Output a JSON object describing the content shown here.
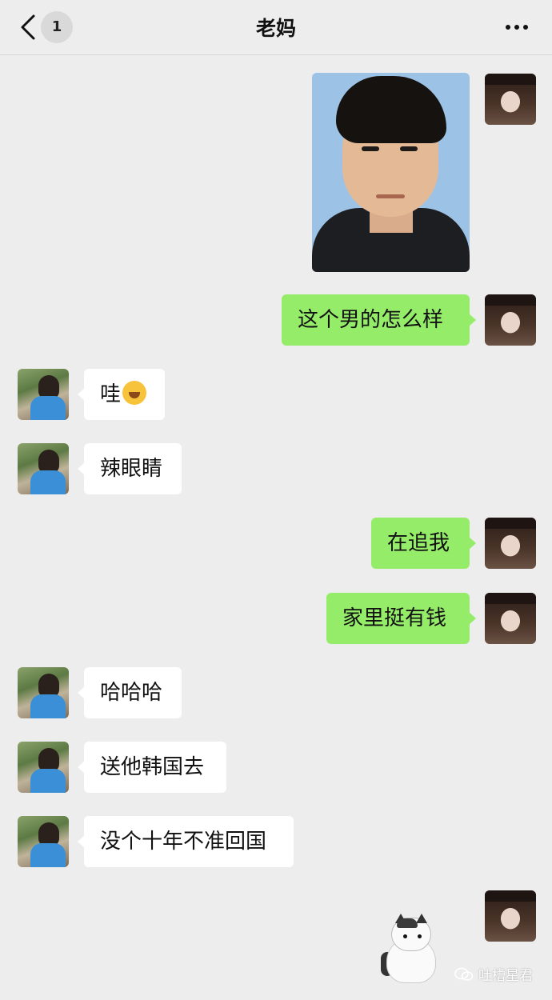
{
  "header": {
    "title": "老妈",
    "unread_count": "1"
  },
  "messages": [
    {
      "side": "right",
      "type": "image",
      "content": "portrait photo of a man"
    },
    {
      "side": "right",
      "type": "text",
      "text": "这个男的怎么样"
    },
    {
      "side": "left",
      "type": "text",
      "text": "哇",
      "emoji": "facepalm-emoji"
    },
    {
      "side": "left",
      "type": "text",
      "text": "辣眼睛"
    },
    {
      "side": "right",
      "type": "text",
      "text": "在追我"
    },
    {
      "side": "right",
      "type": "text",
      "text": "家里挺有钱"
    },
    {
      "side": "left",
      "type": "text",
      "text": "哈哈哈"
    },
    {
      "side": "left",
      "type": "text",
      "text": "送他韩国去"
    },
    {
      "side": "left",
      "type": "text",
      "text": "没个十年不准回国"
    },
    {
      "side": "right",
      "type": "sticker",
      "content": "cat-sticker"
    }
  ],
  "watermark": {
    "text": "吐槽星君"
  },
  "colors": {
    "background": "#ededed",
    "outgoing_bubble": "#95ec69",
    "incoming_bubble": "#ffffff"
  }
}
